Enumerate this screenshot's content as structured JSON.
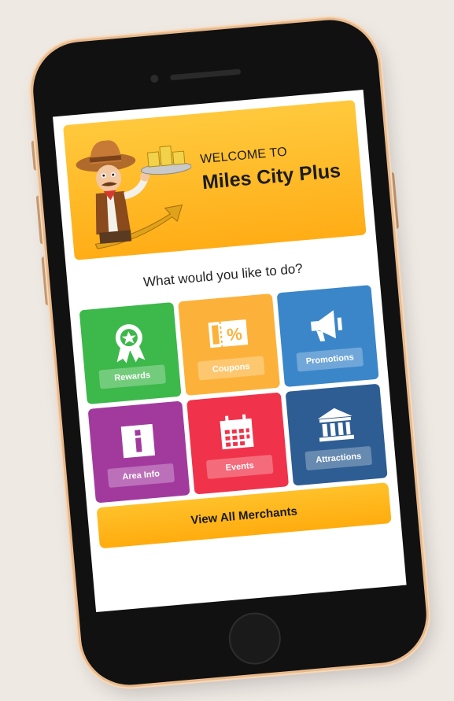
{
  "banner": {
    "welcome_small": "WELCOME TO",
    "welcome_big": "Miles City Plus"
  },
  "prompt": "What would you like to do?",
  "tiles": [
    {
      "label": "Rewards",
      "icon": "ribbon-award-icon",
      "color": "#3db84a"
    },
    {
      "label": "Coupons",
      "icon": "coupon-percent-icon",
      "color": "#fcb23a"
    },
    {
      "label": "Promotions",
      "icon": "megaphone-icon",
      "color": "#3a86c9"
    },
    {
      "label": "Area Info",
      "icon": "info-icon",
      "color": "#a23a9e"
    },
    {
      "label": "Events",
      "icon": "calendar-icon",
      "color": "#f0334a"
    },
    {
      "label": "Attractions",
      "icon": "landmark-building-icon",
      "color": "#2d5d93"
    }
  ],
  "merchants_button": "View All Merchants",
  "colors": {
    "banner": "#ffb21f",
    "background": "#efe9e4",
    "phone_frame": "#111111",
    "phone_trim": "#e8b98d"
  }
}
